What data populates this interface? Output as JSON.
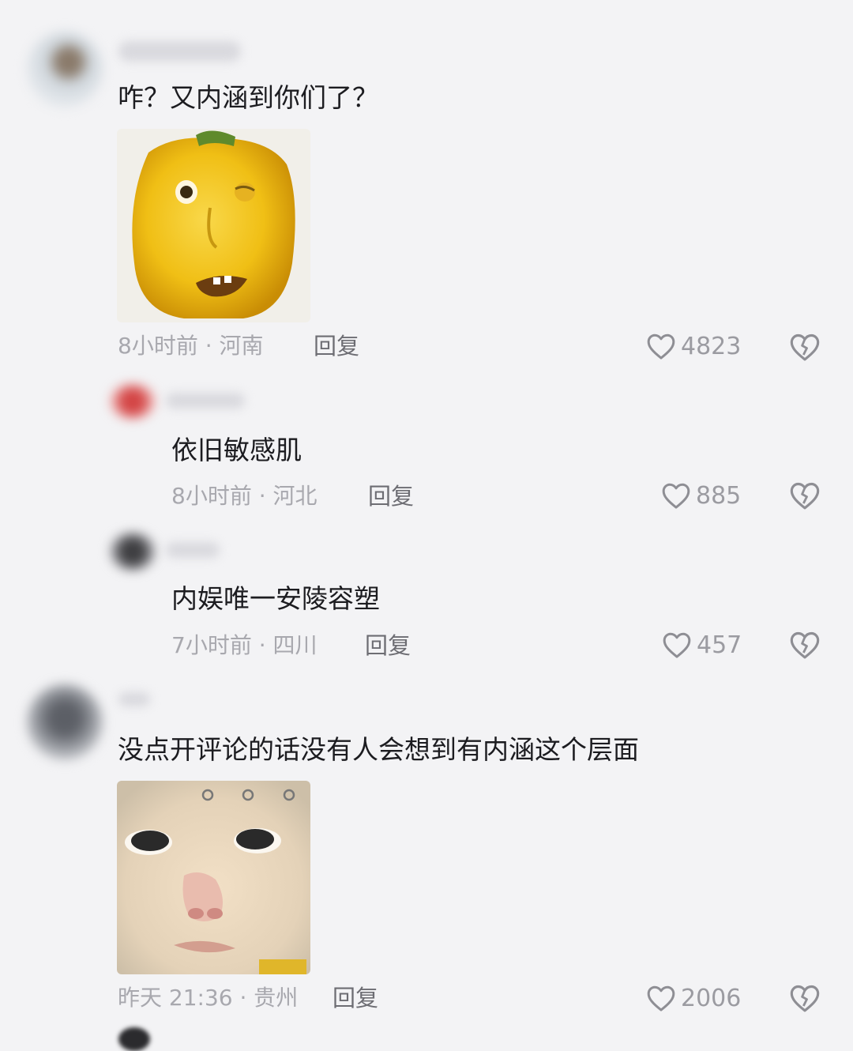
{
  "comments": [
    {
      "text": "咋？又内涵到你们了？",
      "time": "8小时前",
      "location": "河南",
      "reply_label": "回复",
      "likes": "4823",
      "sticker": "yellow-pepper-face-sticker"
    },
    {
      "text": "依旧敏感肌",
      "time": "8小时前",
      "location": "河北",
      "reply_label": "回复",
      "likes": "885"
    },
    {
      "text": "内娱唯一安陵容塑",
      "time": "7小时前",
      "location": "四川",
      "reply_label": "回复",
      "likes": "457"
    },
    {
      "text": "没点开评论的话没有人会想到有内涵这个层面",
      "time": "昨天 21:36",
      "location": "贵州",
      "reply_label": "回复",
      "likes": "2006",
      "sticker": "cat-face-sticker"
    }
  ],
  "colors": {
    "background": "#f3f3f5",
    "text": "#1c1c20",
    "meta": "#a8a8ae",
    "icon": "#8e8e94",
    "pepper": "#f2c21a"
  }
}
